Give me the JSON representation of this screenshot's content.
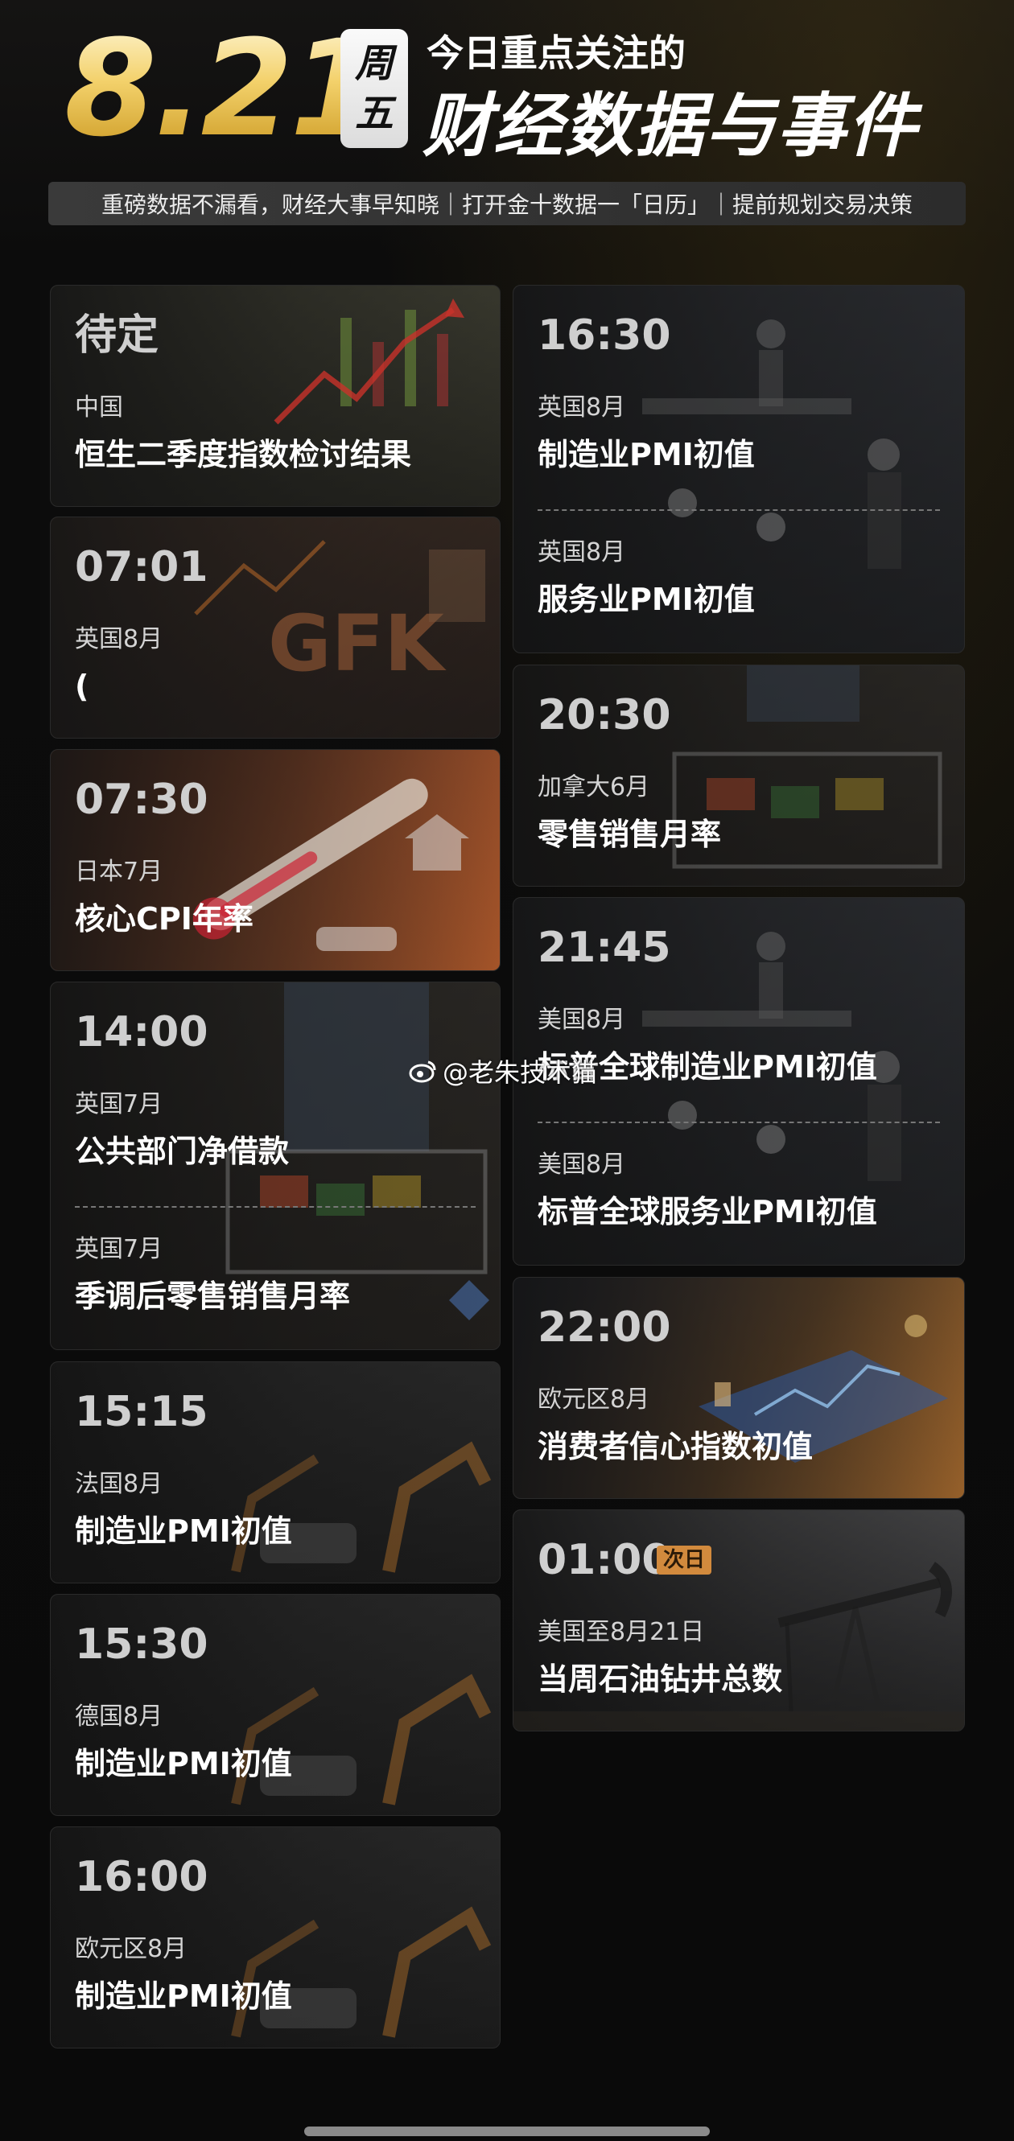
{
  "header": {
    "date": "8.21",
    "weekday_top": "周",
    "weekday_bottom": "五",
    "headline_small": "今日重点关注的",
    "headline_big": "财经数据与事件",
    "banner": "重磅数据不漏看，财经大事早知晓｜打开金十数据一「日历」｜提前规划交易决策"
  },
  "left_cards": [
    {
      "time": "待定",
      "country": "中国",
      "event": "恒生二季度指数检讨结果"
    },
    {
      "time": "07:01",
      "country": "英国8月",
      "event": "("
    },
    {
      "time": "07:30",
      "country": "日本7月",
      "event": "核心CPI年率"
    },
    {
      "time": "14:00",
      "country": "英国7月",
      "event": "公共部门净借款",
      "country2": "英国7月",
      "event2": "季调后零售销售月率"
    },
    {
      "time": "15:15",
      "country": "法国8月",
      "event": "制造业PMI初值"
    },
    {
      "time": "15:30",
      "country": "德国8月",
      "event": "制造业PMI初值"
    },
    {
      "time": "16:00",
      "country": "欧元区8月",
      "event": "制造业PMI初值"
    }
  ],
  "right_cards": [
    {
      "time": "16:30",
      "country": "英国8月",
      "event": "制造业PMI初值",
      "country2": "英国8月",
      "event2": "服务业PMI初值"
    },
    {
      "time": "20:30",
      "country": "加拿大6月",
      "event": "零售销售月率"
    },
    {
      "time": "21:45",
      "country": "美国8月",
      "event": "标普全球制造业PMI初值",
      "country2": "美国8月",
      "event2": "标普全球服务业PMI初值"
    },
    {
      "time": "22:00",
      "country": "欧元区8月",
      "event": "消费者信心指数初值"
    },
    {
      "time": "01:00",
      "badge": "次日",
      "country": "美国至8月21日",
      "event": "当周石油钻井总数"
    }
  ],
  "watermark": "@老朱技术猫",
  "icons": {
    "watermark": "weibo-icon"
  },
  "colors": {
    "gold": "#f3d16b",
    "badge": "#d28a3d",
    "background": "#0b0b0b"
  }
}
